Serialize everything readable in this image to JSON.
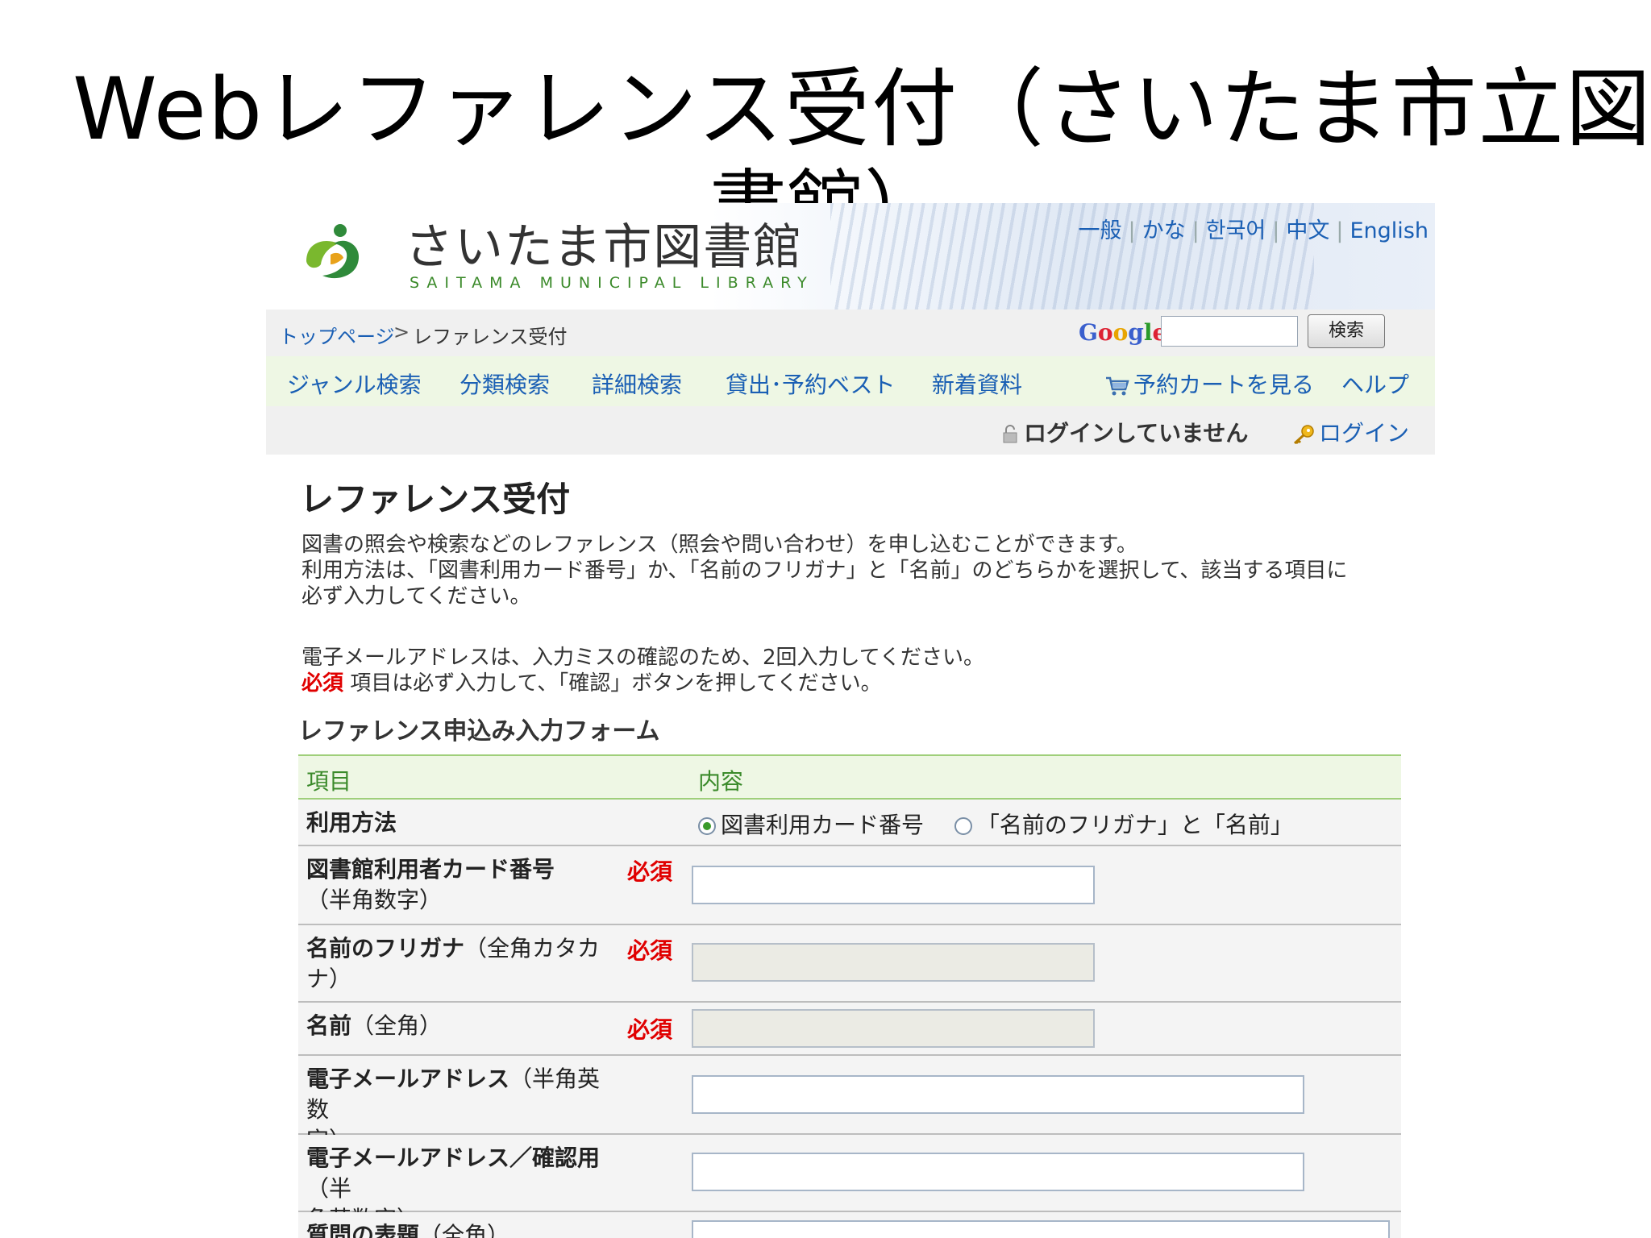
{
  "slide": {
    "title_part1": "Web",
    "title_part2": "レファレンス受付（さいたま市立図",
    "title_line2": "書館）"
  },
  "header": {
    "logo_text": "さいたま市図書館",
    "logo_sub": "SAITAMA MUNICIPAL LIBRARY",
    "lang_links": [
      "一般",
      "かな",
      "한국어",
      "中文",
      "English"
    ]
  },
  "breadcrumb": {
    "home": "トップページ",
    "separator": ">",
    "current": "レファレンス受付"
  },
  "search": {
    "google_letters": [
      "G",
      "o",
      "o",
      "g",
      "l",
      "e"
    ],
    "button": "検索"
  },
  "nav": {
    "items": [
      "ジャンル検索",
      "分類検索",
      "詳細検索",
      "貸出･予約ベスト",
      "新着資料"
    ],
    "cart": "予約カートを見る",
    "help": "ヘルプ"
  },
  "login": {
    "status": "ログインしていません",
    "link": "ログイン"
  },
  "page": {
    "heading": "レファレンス受付",
    "intro_1": "図書の照会や検索などのレファレンス（照会や問い合わせ）を申し込むことができます。",
    "intro_2": "利用方法は、「図書利用カード番号」か、「名前のフリガナ」と「名前」のどちらかを選択して、該当する項目に",
    "intro_3": "必ず入力してください。",
    "intro_4": "電子メールアドレスは、入力ミスの確認のため、2回入力してください。",
    "intro_req": "必須",
    "intro_5": "項目は必ず入力して、「確認」ボタンを押してください。",
    "form_title": "レファレンス申込み入力フォーム"
  },
  "form": {
    "col_item": "項目",
    "col_content": "内容",
    "required": "必須",
    "method_label": "利用方法",
    "method_options": [
      "図書利用カード番号",
      "「名前のフリガナ」と「名前」"
    ],
    "method_selected": "図書利用カード番号",
    "card_label": "図書館利用者カード番号",
    "card_hint": "（半角数字）",
    "kana_label": "名前のフリガナ",
    "kana_hint": "（全角カタカ",
    "kana_hint2": "ナ）",
    "name_label": "名前",
    "name_hint": "（全角）",
    "email_label": "電子メールアドレス",
    "email_hint": "（半角英数",
    "email_hint2": "字）",
    "email2_label": "電子メールアドレス／確認用",
    "email2_hint": "（半",
    "email2_hint2": "角英数字）",
    "subject_label": "質問の表題",
    "subject_hint": "（全角）"
  },
  "colors": {
    "link": "#1a5fb4",
    "required": "#e00000",
    "table_head_bg": "#eef7e4",
    "table_head_text": "#3a8a2a"
  }
}
